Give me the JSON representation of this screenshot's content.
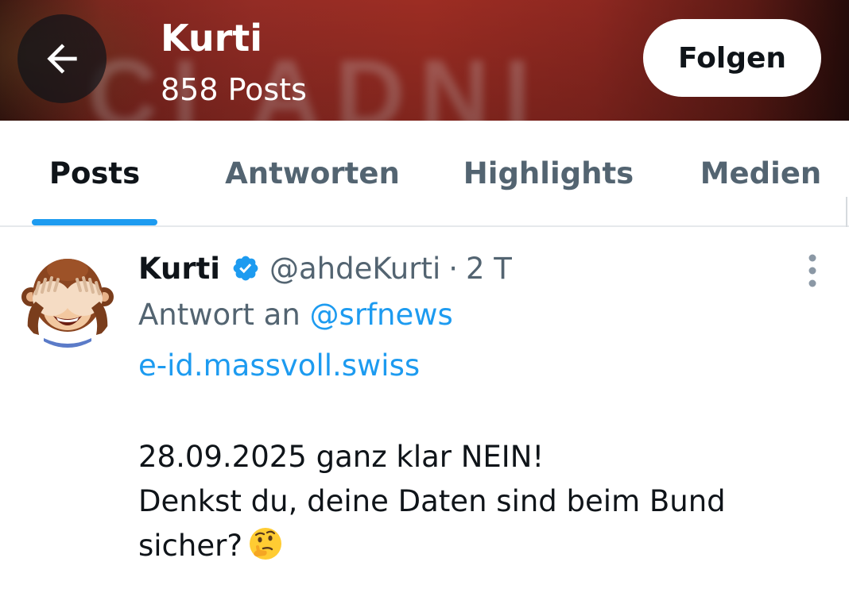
{
  "header": {
    "back_icon": "arrow-left-icon",
    "title": "Kurti",
    "subtitle": "858 Posts",
    "follow_label": "Folgen",
    "banner_colors": {
      "primary": "#b23328",
      "dark": "#2a0d0b"
    }
  },
  "tabs": [
    {
      "label": "Posts",
      "active": true
    },
    {
      "label": "Antworten",
      "active": false
    },
    {
      "label": "Highlights",
      "active": false
    },
    {
      "label": "Medien",
      "active": false
    }
  ],
  "post": {
    "author_name": "Kurti",
    "verified_icon": "verified-badge-icon",
    "handle": "@ahdeKurti",
    "separator": "·",
    "time": "2 T",
    "more_icon": "more-vertical-icon",
    "reply_prefix": "Antwort an",
    "reply_to": "@srfnews",
    "link": "e-id.massvoll.swiss",
    "text_lines": [
      "28.09.2025 ganz klar NEIN!",
      "Denkst du, deine Daten sind beim Bund",
      "sicher?"
    ],
    "emoji_icon": "thinking-face-icon",
    "avatar_icon": "see-no-evil-monkey-icon"
  },
  "colors": {
    "accent": "#1d9bf0",
    "text_primary": "#0f1419",
    "text_secondary": "#536471"
  }
}
